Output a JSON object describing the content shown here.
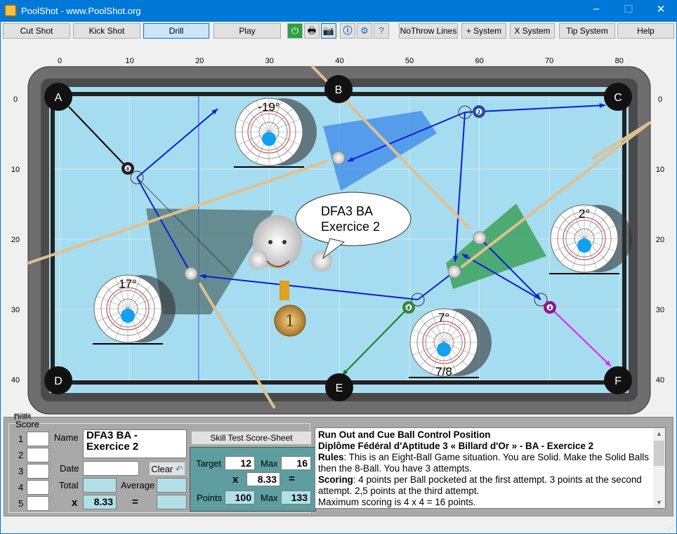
{
  "window": {
    "title": "PoolShot - www.PoolShot.org",
    "minimize": "–",
    "maximize": "☐",
    "close": "✕"
  },
  "toolbar": {
    "buttons": [
      "Cut Shot",
      "Kick Shot",
      "Drill",
      "Play"
    ],
    "active": "Drill",
    "icons": [
      "power-icon",
      "print-icon",
      "camera-icon",
      "info-icon",
      "settings-icon",
      "help-doc-icon"
    ],
    "buttons2": [
      "NoThrow Lines",
      "+ System",
      "X System",
      "Tip System",
      "Help"
    ]
  },
  "table": {
    "top_axis": [
      "0",
      "10",
      "20",
      "30",
      "40",
      "50",
      "60",
      "70",
      "80"
    ],
    "side_axis": [
      "0",
      "10",
      "20",
      "30",
      "40"
    ],
    "pockets": [
      "A",
      "B",
      "C",
      "D",
      "E",
      "F"
    ],
    "balls": [
      {
        "number": "8",
        "color": "#222222"
      },
      {
        "number": "2",
        "color": "#1f4fa8"
      },
      {
        "number": "6",
        "color": "#2e8b3e"
      },
      {
        "number": "4",
        "color": "#8b1a8b"
      }
    ],
    "spin_diagrams": [
      {
        "angle": "-19°"
      },
      {
        "angle": "17°"
      },
      {
        "angle": "7°",
        "fraction": "7/8"
      },
      {
        "angle": "2°"
      }
    ],
    "bubble": [
      "DFA3 BA",
      "Exercice 2"
    ],
    "medal": "1",
    "colors": {
      "cloth": "#a6dcef",
      "rail": "#6e6e6e",
      "line_blue": "#0a1fd6",
      "line_green": "#1a7a1a",
      "line_magenta": "#e81ee8"
    }
  },
  "drills": {
    "group_label": "Drills",
    "score_label": "Score",
    "rows": [
      "1",
      "2",
      "3",
      "4",
      "5"
    ],
    "name_label": "Name",
    "name_value": "DFA3 BA - Exercice 2",
    "date_label": "Date",
    "date_value": "",
    "clear_label": "Clear",
    "total_label": "Total",
    "total_value": "",
    "average_label": "Average",
    "average_value": "",
    "x_symbol": "x",
    "multiplier": "8.33",
    "equals": "=",
    "result": "",
    "score_sheet_button": "Skill Test Score-Sheet",
    "target_label": "Target",
    "target": "12",
    "max_label": "Max",
    "max": "16",
    "sheet_multiplier": "8.33",
    "points_label": "Points",
    "points": "100",
    "points_max": "133"
  },
  "description": {
    "line1": "Run Out and Cue Ball Control Position",
    "line2": "Diplôme Fédéral d'Aptitude 3 « Billard d'Or » - BA - Exercice 2",
    "rules_label": "Rules",
    "rules": ": This is an Eight-Ball Game situation. You are Solid. Make the Solid Balls then the 8-Ball. You have 3 attempts.",
    "scoring_label": "Scoring",
    "scoring": ": 4 points per Ball pocketed at the first attempt. 3 points at the second attempt. 2,5 points at the third attempt.",
    "max_line": "Maximum scoring is 4 x 4 = 16 points."
  }
}
